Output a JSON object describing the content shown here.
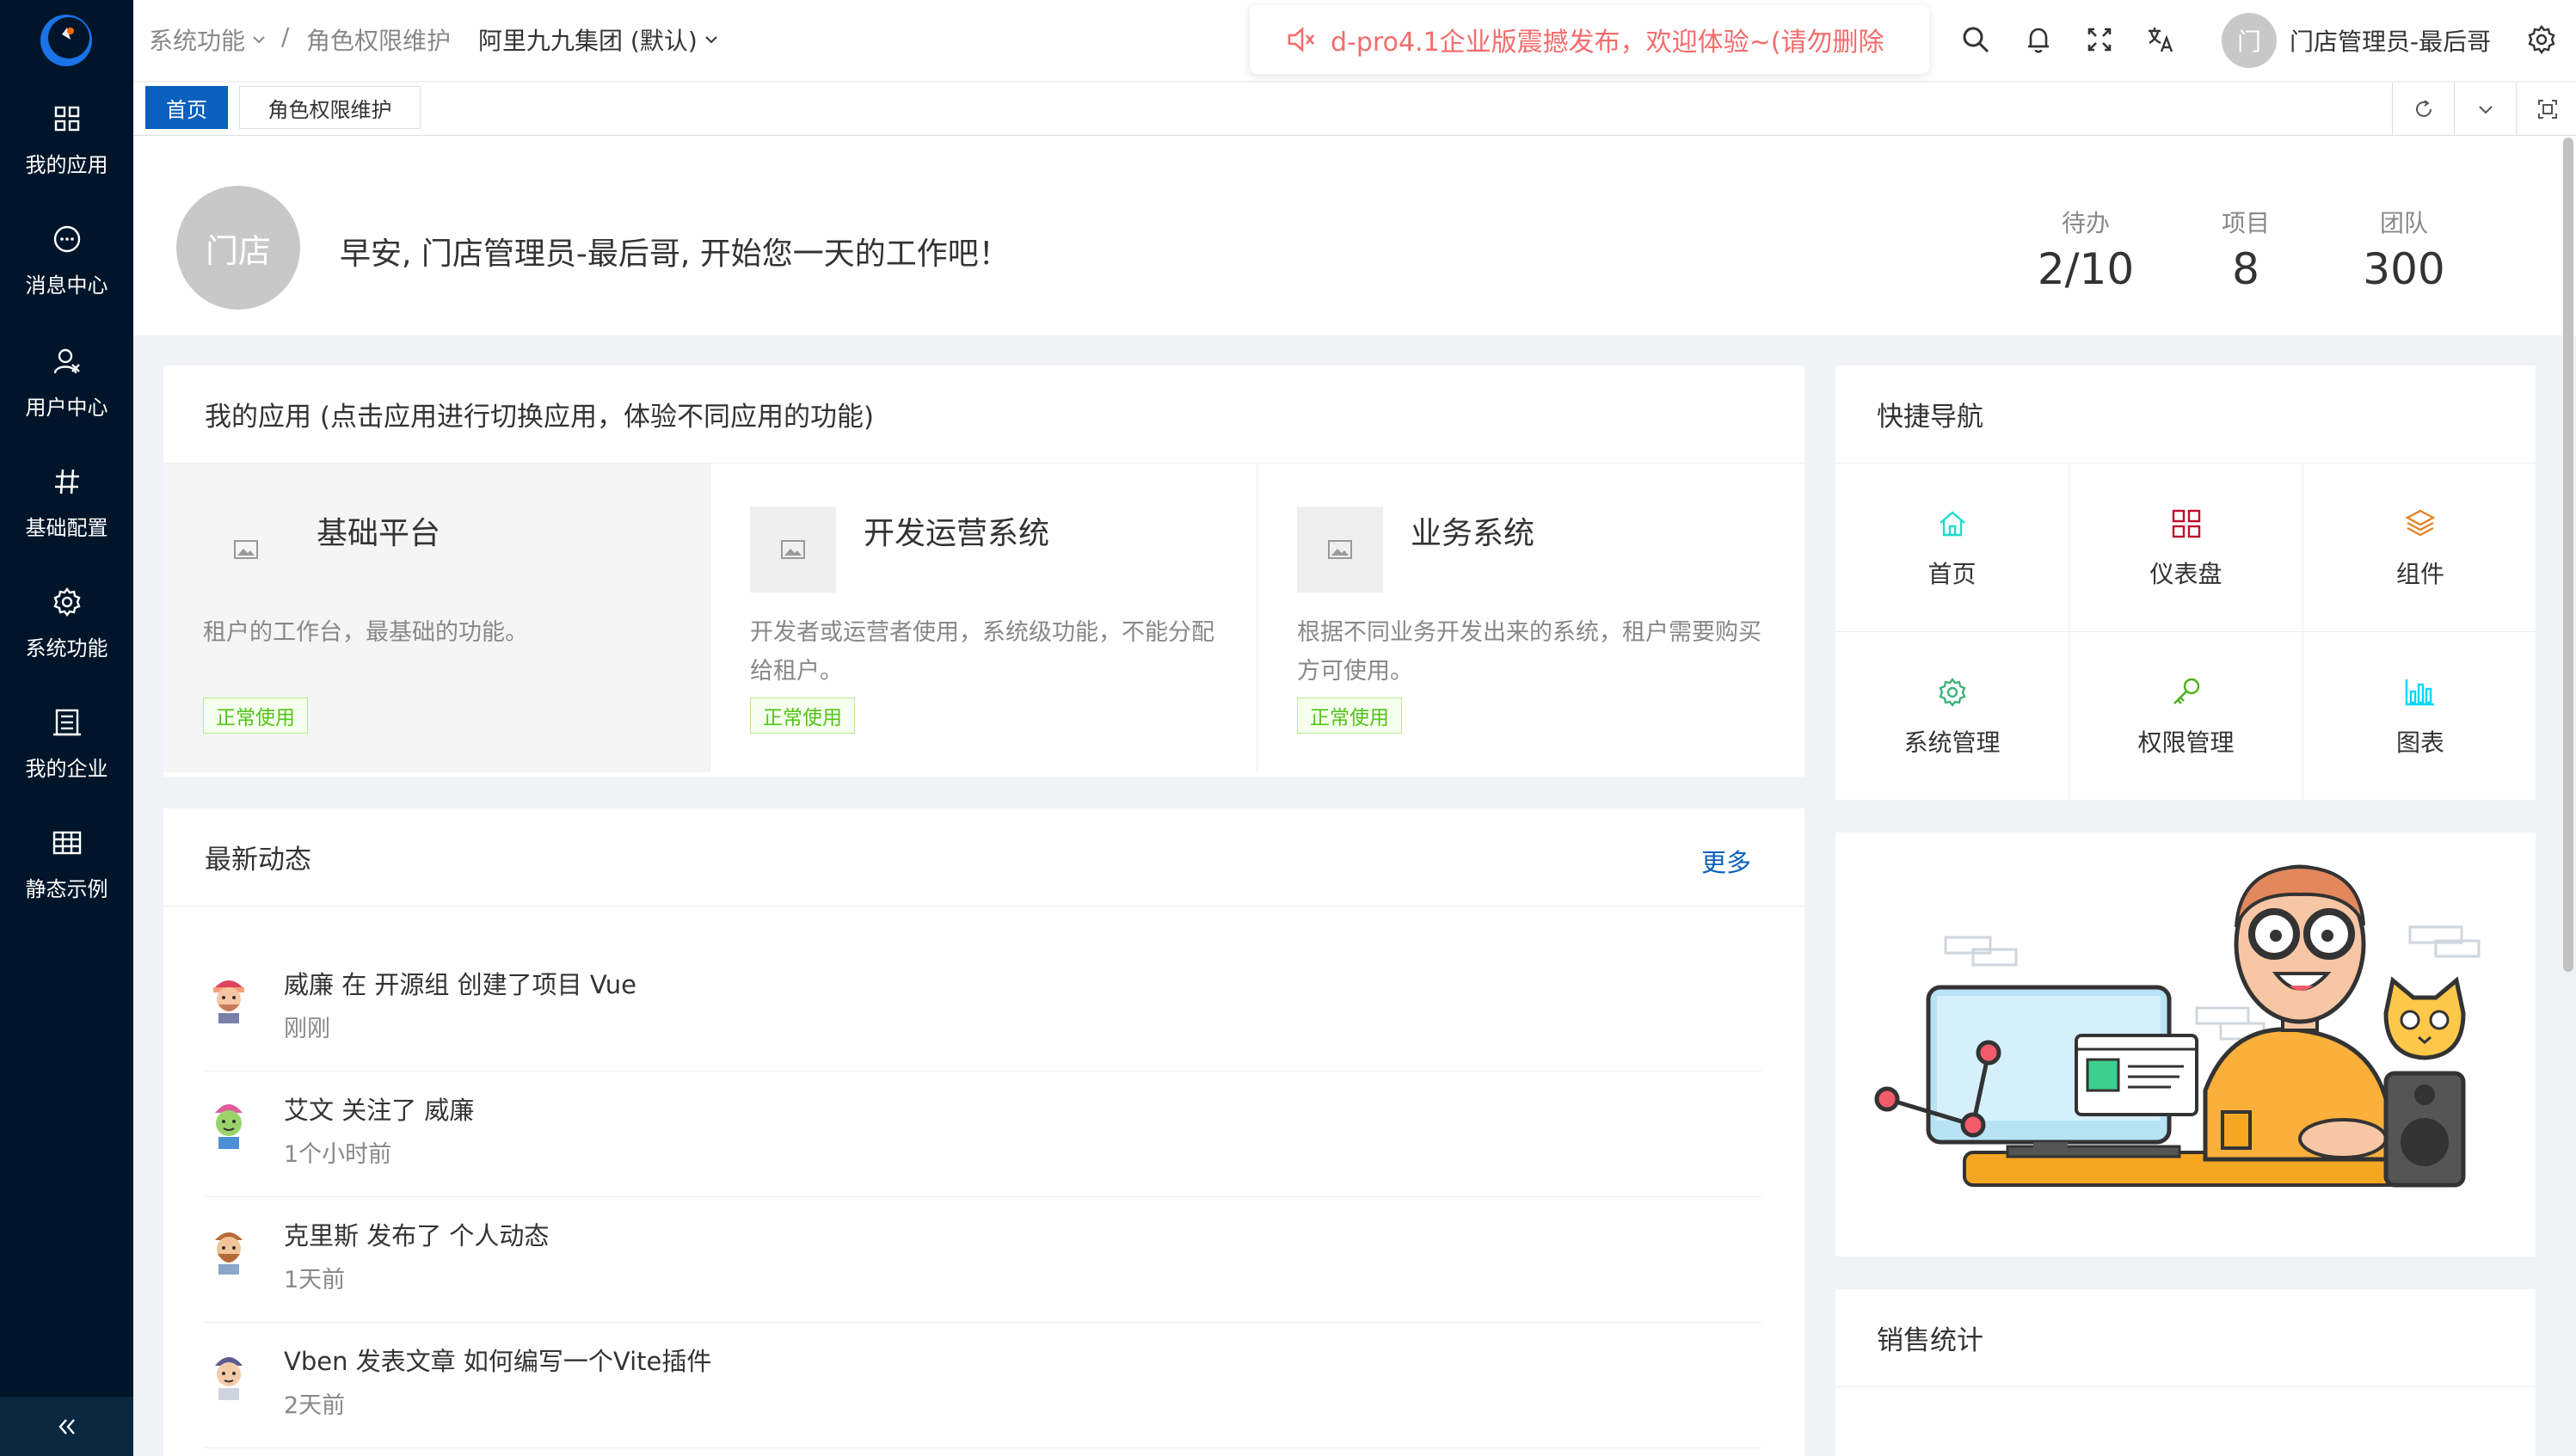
{
  "header": {
    "breadcrumb1": "系统功能",
    "breadcrumb_sep": "/",
    "breadcrumb2": "角色权限维护",
    "org_selector": "阿里九九集团 (默认)",
    "notice": "d-pro4.1企业版震撼发布，欢迎体验~(请勿删除",
    "avatar_text": "门",
    "username": "门店管理员-最后哥",
    "icons": [
      "search-icon",
      "bell-icon",
      "fullscreen-icon",
      "translate-icon",
      "settings-icon"
    ]
  },
  "sidebar": {
    "items": [
      {
        "label": "我的应用",
        "icon": "apps-grid-icon"
      },
      {
        "label": "消息中心",
        "icon": "message-icon"
      },
      {
        "label": "用户中心",
        "icon": "user-center-icon"
      },
      {
        "label": "基础配置",
        "icon": "hash-icon"
      },
      {
        "label": "系统功能",
        "icon": "gear-icon"
      },
      {
        "label": "我的企业",
        "icon": "enterprise-icon"
      },
      {
        "label": "静态示例",
        "icon": "table-icon"
      }
    ]
  },
  "tabs": [
    {
      "label": "首页",
      "active": true
    },
    {
      "label": "角色权限维护",
      "active": false
    }
  ],
  "greeting": {
    "avatar_text": "门店",
    "text": "早安, 门店管理员-最后哥, 开始您一天的工作吧！",
    "stats": [
      {
        "label": "待办",
        "value": "2/10"
      },
      {
        "label": "项目",
        "value": "8"
      },
      {
        "label": "团队",
        "value": "300"
      }
    ]
  },
  "apps": {
    "title": "我的应用 (点击应用进行切换应用，体验不同应用的功能)",
    "items": [
      {
        "name": "基础平台",
        "desc": "租户的工作台，最基础的功能。",
        "status": "正常使用"
      },
      {
        "name": "开发运营系统",
        "desc": "开发者或运营者使用，系统级功能，不能分配给租户。",
        "status": "正常使用"
      },
      {
        "name": "业务系统",
        "desc": "根据不同业务开发出来的系统，租户需要购买方可使用。",
        "status": "正常使用"
      }
    ]
  },
  "feed": {
    "title": "最新动态",
    "more": "更多",
    "items": [
      {
        "text": "威廉 在 开源组 创建了项目 Vue",
        "time": "刚刚"
      },
      {
        "text": "艾文 关注了 威廉",
        "time": "1个小时前"
      },
      {
        "text": "克里斯 发布了 个人动态",
        "time": "1天前"
      },
      {
        "text": "Vben 发表文章 如何编写一个Vite插件",
        "time": "2天前"
      }
    ]
  },
  "quicknav": {
    "title": "快捷导航",
    "items": [
      {
        "label": "首页",
        "icon": "home-icon",
        "color": "#1fdaca"
      },
      {
        "label": "仪表盘",
        "icon": "dashboard-icon",
        "color": "#bf0c2c"
      },
      {
        "label": "组件",
        "icon": "layers-icon",
        "color": "#e18525"
      },
      {
        "label": "系统管理",
        "icon": "setting-icon",
        "color": "#3fb27f"
      },
      {
        "label": "权限管理",
        "icon": "key-icon",
        "color": "#4daf1bc9"
      },
      {
        "label": "图表",
        "icon": "chart-icon",
        "color": "#00d8ff"
      }
    ]
  },
  "sales": {
    "title": "销售统计"
  }
}
